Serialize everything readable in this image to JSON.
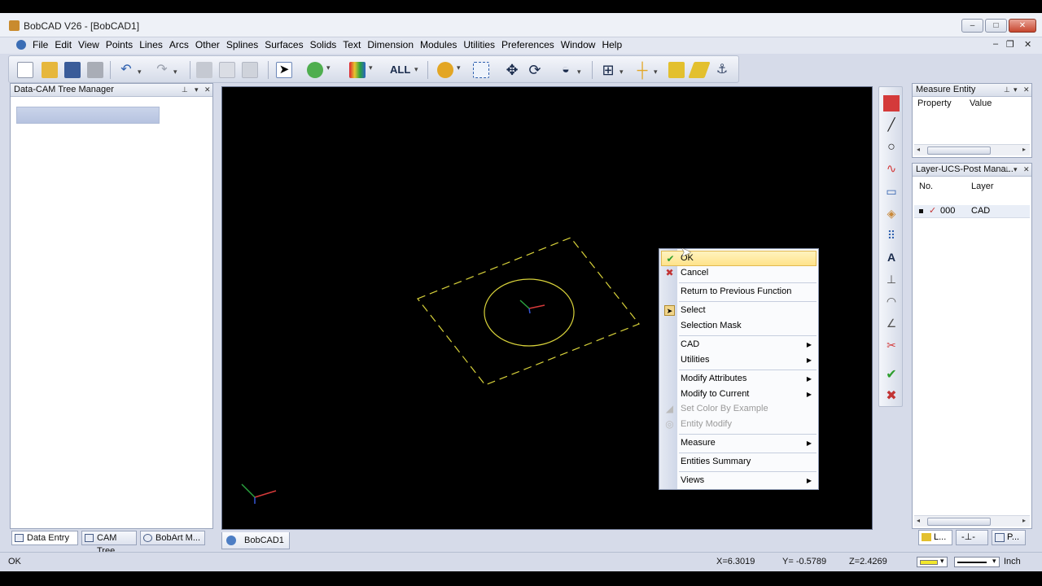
{
  "window": {
    "title": "BobCAD V26 - [BobCAD1]"
  },
  "menu": {
    "items": [
      "File",
      "Edit",
      "View",
      "Points",
      "Lines",
      "Arcs",
      "Other",
      "Splines",
      "Surfaces",
      "Solids",
      "Text",
      "Dimension",
      "Modules",
      "Utilities",
      "Preferences",
      "Window",
      "Help"
    ]
  },
  "toolbar": {
    "all_label": "ALL"
  },
  "left_panel": {
    "title": "Data-CAM Tree Manager",
    "tabs": [
      "Data Entry",
      "CAM Tree",
      "BobArt M..."
    ]
  },
  "viewport": {
    "document_tab": "BobCAD1"
  },
  "measure_panel": {
    "title": "Measure Entity",
    "col_property": "Property",
    "col_value": "Value"
  },
  "layer_panel": {
    "title": "Layer-UCS-Post Mana...",
    "col_no": "No.",
    "col_layer": "Layer",
    "rows": [
      {
        "no": "000",
        "layer": "CAD"
      }
    ],
    "tabs": [
      "L...",
      "P..."
    ]
  },
  "context_menu": {
    "items": [
      {
        "label": "OK"
      },
      {
        "label": "Cancel"
      },
      {
        "label": "Return to Previous Function"
      },
      {
        "label": "Select"
      },
      {
        "label": "Selection Mask"
      },
      {
        "label": "CAD"
      },
      {
        "label": "Utilities"
      },
      {
        "label": "Modify Attributes"
      },
      {
        "label": "Modify to Current"
      },
      {
        "label": "Set Color By Example"
      },
      {
        "label": "Entity Modify"
      },
      {
        "label": "Measure"
      },
      {
        "label": "Entities Summary"
      },
      {
        "label": "Views"
      }
    ]
  },
  "status": {
    "message": "OK",
    "x": "X=6.3019",
    "y": "Y= -0.5789",
    "z": "Z=2.4269",
    "units": "Inch"
  },
  "colors": {
    "geometry": "#d8d23a",
    "viewport_bg": "#000000",
    "highlight": "#ffe38a"
  }
}
